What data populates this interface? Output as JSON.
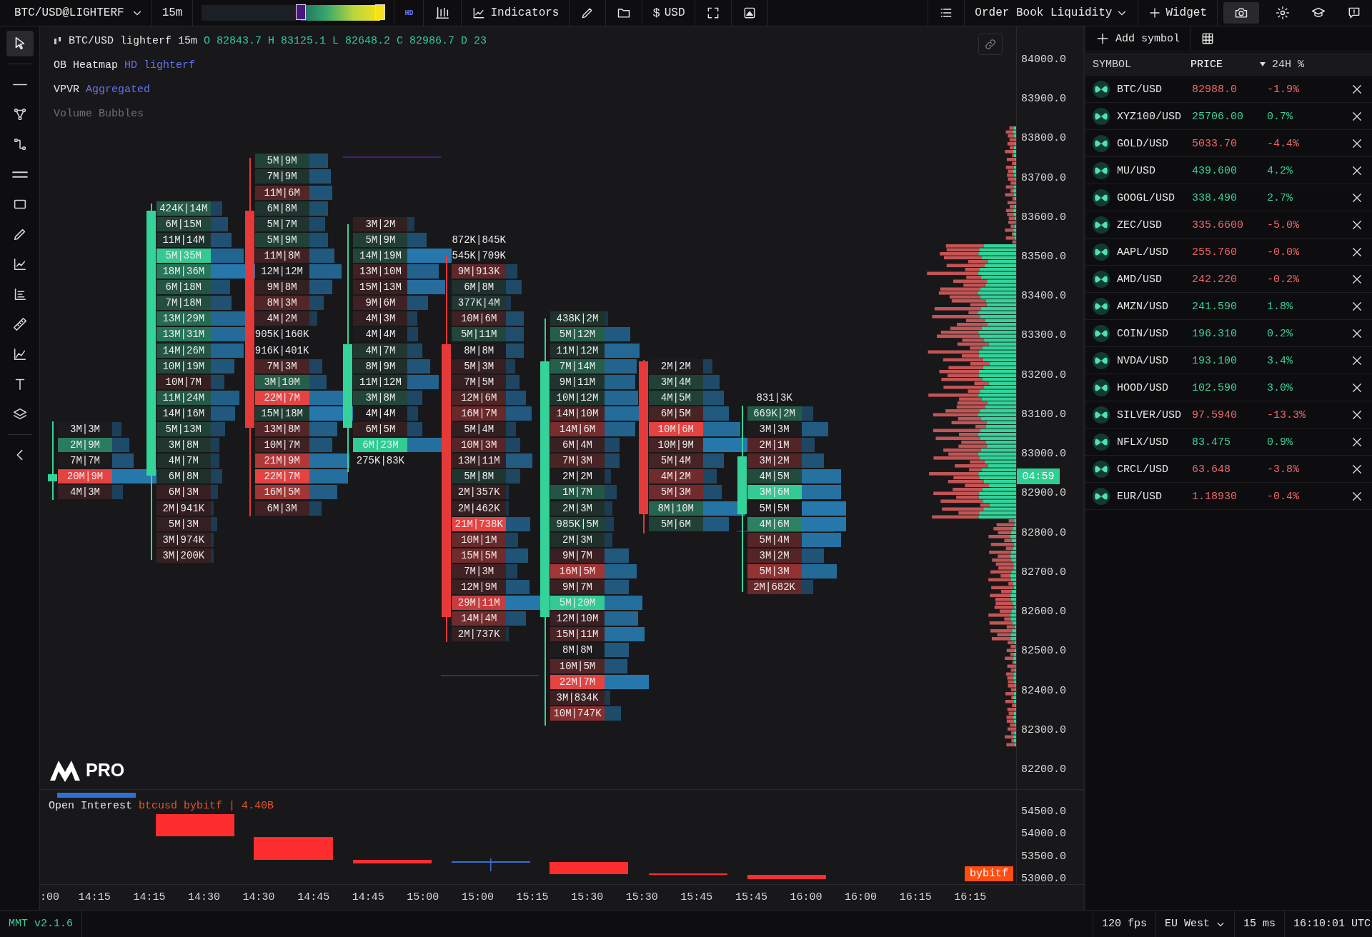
{
  "top_bar": {
    "symbol": "BTC/USD@LIGHTERF",
    "interval": "15m",
    "heatmap_range": {
      "low": {
        "level": 0.54
      },
      "high": {
        "level": 0.97
      }
    },
    "hd_badge": "HD",
    "indicators_button": "Indicators",
    "currency_symbol": "$",
    "currency_button": "USD",
    "layout_menu": "Order Book Liquidity",
    "widget_button": "Widget"
  },
  "toolbar": {
    "tools": [
      {
        "selected": true
      },
      {
        "selected": false
      },
      {
        "selected": false
      },
      {
        "selected": false
      },
      {
        "selected": false
      },
      {
        "selected": false
      },
      {
        "selected": false
      },
      {
        "selected": false
      },
      {
        "selected": false
      },
      {
        "selected": false
      },
      {
        "selected": false
      },
      {
        "selected": false
      },
      {
        "selected": false
      },
      {
        "selected": false
      }
    ]
  },
  "chart": {
    "legend": {
      "symbol": "BTC/USD lighterf 15m",
      "ohlc": "O 82843.7 H 83125.1 L 82648.2 C 82986.7 D 23"
    },
    "indicators": [
      {
        "name": "OB Heatmap",
        "source": "HD lighterf",
        "visible": true
      },
      {
        "name": "VPVR",
        "source": "Aggregated",
        "visible": true
      },
      {
        "name": "Volume Bubbles",
        "visible": false
      }
    ],
    "candles": [
      {
        "rising": true,
        "cells": [
          "3M|3M",
          "2M|9M",
          "7M|7M",
          "20M|9M",
          "4M|3M"
        ]
      },
      {
        "rising": true,
        "cells": [
          "424K|14M",
          "6M|15M",
          "11M|14M",
          "5M|35M",
          "18M|36M",
          "6M|18M",
          "7M|18M",
          "13M|29M",
          "13M|31M",
          "14M|26M",
          "10M|19M",
          "10M|7M",
          "11M|24M",
          "14M|16M",
          "5M|13M",
          "3M|8M",
          "4M|7M",
          "6M|8M",
          "6M|3M",
          "2M|941K",
          "5M|3M",
          "3M|974K",
          "3M|200K"
        ]
      },
      {
        "rising": false,
        "cells": [
          "5M|9M",
          "7M|9M",
          "11M|6M",
          "6M|8M",
          "5M|7M",
          "5M|9M",
          "11M|8M",
          "12M|12M",
          "9M|8M",
          "8M|3M",
          "4M|2M",
          "905K|160K",
          "916K|401K",
          "7M|3M",
          "3M|10M",
          "22M|7M",
          "15M|18M",
          "13M|8M",
          "10M|7M",
          "21M|9M",
          "22M|7M",
          "16M|5M",
          "6M|3M"
        ]
      },
      {
        "rising": true,
        "cells": [
          "3M|2M",
          "5M|9M",
          "14M|19M",
          "13M|10M",
          "15M|13M",
          "9M|6M",
          "4M|3M",
          "4M|4M",
          "4M|7M",
          "8M|9M",
          "11M|12M",
          "3M|8M",
          "4M|4M",
          "6M|5M",
          "6M|23M",
          "275K|83K"
        ]
      },
      {
        "rising": false,
        "cells": [
          "872K|845K",
          "545K|709K",
          "9M|913K",
          "6M|8M",
          "377K|4M",
          "10M|6M",
          "5M|11M",
          "8M|8M",
          "5M|3M",
          "7M|5M",
          "12M|6M",
          "16M|7M",
          "5M|4M",
          "10M|3M",
          "13M|11M",
          "5M|8M",
          "2M|357K",
          "2M|462K",
          "21M|738K",
          "10M|1M",
          "15M|5M",
          "7M|3M",
          "12M|9M",
          "29M|11M",
          "14M|4M",
          "2M|737K"
        ]
      },
      {
        "rising": true,
        "cells": [
          "438K|2M",
          "5M|12M",
          "11M|12M",
          "7M|14M",
          "9M|11M",
          "10M|12M",
          "14M|10M",
          "14M|6M",
          "6M|4M",
          "7M|3M",
          "2M|2M",
          "1M|7M",
          "2M|3M",
          "985K|5M",
          "2M|3M",
          "9M|7M",
          "16M|5M",
          "9M|7M",
          "5M|20M",
          "12M|10M",
          "15M|11M",
          "8M|8M",
          "10M|5M",
          "22M|7M",
          "3M|834K",
          "10M|747K"
        ]
      },
      {
        "rising": false,
        "cells": [
          "2M|2M",
          "3M|4M",
          "4M|5M",
          "6M|5M",
          "10M|6M",
          "10M|9M",
          "5M|4M",
          "4M|2M",
          "5M|3M",
          "8M|10M",
          "5M|6M"
        ]
      },
      {
        "rising": true,
        "cells": [
          "831|3K",
          "669K|2M",
          "3M|3M",
          "2M|1M",
          "3M|2M",
          "4M|5M",
          "3M|6M",
          "5M|5M",
          "4M|6M",
          "5M|4M",
          "3M|2M",
          "5M|3M",
          "2M|682K"
        ]
      }
    ],
    "price_axis": [
      "84000.0",
      "83900.0",
      "83800.0",
      "83700.0",
      "83600.0",
      "83500.0",
      "83400.0",
      "83300.0",
      "83200.0",
      "83100.0",
      "83000.0",
      "82900.0",
      "82800.0",
      "82700.0",
      "82600.0",
      "82500.0",
      "82400.0",
      "82300.0",
      "82200.0"
    ],
    "countdown": "04:59",
    "logo": "PRO"
  },
  "open_interest": {
    "title": "Open Interest",
    "series": "btcusd bybitf | 4.40B",
    "price_axis": [
      "54500.0",
      "54000.0",
      "53500.0",
      "53000.0"
    ],
    "exchange_tag": "bybitf"
  },
  "time_axis": [
    ":00",
    "14:15",
    "14:15",
    "14:30",
    "14:30",
    "14:45",
    "14:45",
    "15:00",
    "15:00",
    "15:15",
    "15:30",
    "15:30",
    "15:45",
    "15:45",
    "16:00",
    "16:00",
    "16:15",
    "16:15"
  ],
  "watchlist": {
    "add_button": "Add symbol",
    "columns": [
      {
        "label": "SYMBOL",
        "sorted_descending": false
      },
      {
        "label": "PRICE",
        "sorted_descending": true
      },
      {
        "label": "24H %",
        "sorted_descending": false
      }
    ],
    "rows": [
      {
        "symbol": "BTC/USD",
        "price": "82988.0",
        "change": "-1.9%",
        "rising": false
      },
      {
        "symbol": "XYZ100/USD",
        "price": "25706.00",
        "change": "0.7%",
        "rising": true
      },
      {
        "symbol": "GOLD/USD",
        "price": "5033.70",
        "change": "-4.4%",
        "rising": false
      },
      {
        "symbol": "MU/USD",
        "price": "439.600",
        "change": "4.2%",
        "rising": true
      },
      {
        "symbol": "GOOGL/USD",
        "price": "338.490",
        "change": "2.7%",
        "rising": true
      },
      {
        "symbol": "ZEC/USD",
        "price": "335.6600",
        "change": "-5.0%",
        "rising": false
      },
      {
        "symbol": "AAPL/USD",
        "price": "255.760",
        "change": "-0.0%",
        "rising": false
      },
      {
        "symbol": "AMD/USD",
        "price": "242.220",
        "change": "-0.2%",
        "rising": false
      },
      {
        "symbol": "AMZN/USD",
        "price": "241.590",
        "change": "1.8%",
        "rising": true
      },
      {
        "symbol": "COIN/USD",
        "price": "196.310",
        "change": "0.2%",
        "rising": true
      },
      {
        "symbol": "NVDA/USD",
        "price": "193.100",
        "change": "3.4%",
        "rising": true
      },
      {
        "symbol": "HOOD/USD",
        "price": "102.590",
        "change": "3.0%",
        "rising": true
      },
      {
        "symbol": "SILVER/USD",
        "price": "97.5940",
        "change": "-13.3%",
        "rising": false
      },
      {
        "symbol": "NFLX/USD",
        "price": "83.475",
        "change": "0.9%",
        "rising": true
      },
      {
        "symbol": "CRCL/USD",
        "price": "63.648",
        "change": "-3.8%",
        "rising": false
      },
      {
        "symbol": "EUR/USD",
        "price": "1.18930",
        "change": "-0.4%",
        "rising": false
      }
    ]
  },
  "status_bar": {
    "version": "MMT v2.1.6",
    "fps": "120 fps",
    "region": "EU West",
    "latency": "15 ms",
    "clock": "16:10:01 UTC"
  }
}
